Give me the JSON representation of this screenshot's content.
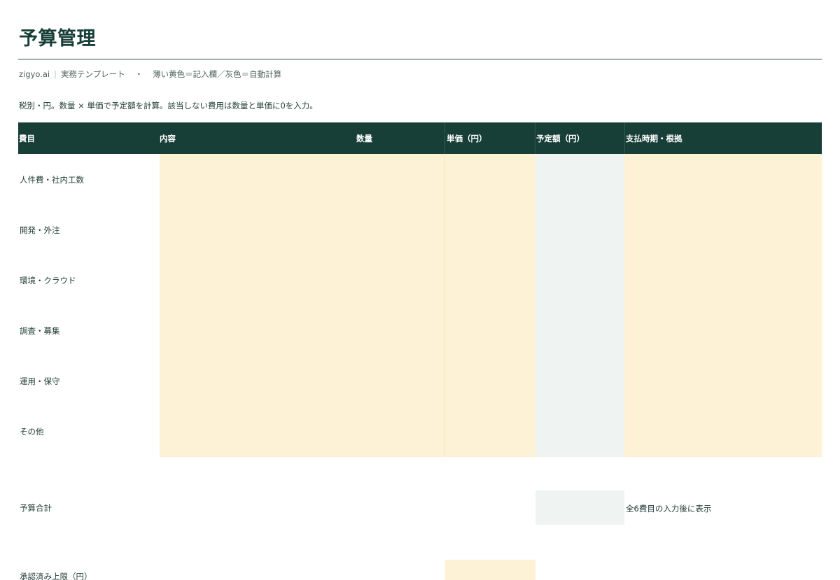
{
  "page": {
    "title": "予算管理",
    "brand": "zigyo.ai",
    "separator": "|",
    "template_label": "実務テンプレート",
    "dot": "・",
    "legend": "薄い黄色＝記入欄／灰色＝自動計算",
    "note": "税別・円。数量 × 単価で予定額を計算。該当しない費用は数量と単価に0を入力。"
  },
  "table": {
    "headers": {
      "category": "費目",
      "content": "内容",
      "quantity": "数量",
      "unit_price": "単価（円）",
      "planned": "予定額（円）",
      "timing": "支払時期・根拠"
    },
    "rows": [
      {
        "category": "人件費・社内工数"
      },
      {
        "category": "開発・外注"
      },
      {
        "category": "環境・クラウド"
      },
      {
        "category": "調査・募集"
      },
      {
        "category": "運用・保守"
      },
      {
        "category": "その他"
      }
    ]
  },
  "summary": {
    "total_label": "予算合計",
    "total_note": "全6費目の入力後に表示",
    "approved_label": "承認済み上限（円）"
  },
  "colors": {
    "header_bg": "#173f37",
    "input_yellow": "#fdf2d6",
    "auto_gray": "#eff3f1"
  }
}
